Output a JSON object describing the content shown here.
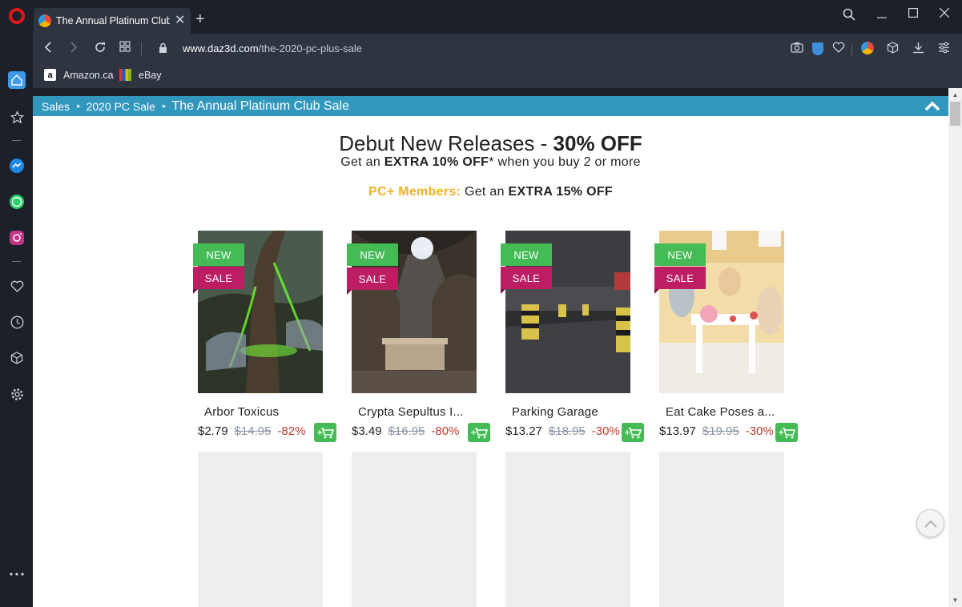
{
  "browser": {
    "tab_title": "The Annual Platinum Club Sale",
    "url_host": "www.daz3d.com",
    "url_path": "/the-2020-pc-plus-sale",
    "bookmarks": [
      {
        "label": "Amazon.ca",
        "icon": "amazon-icon"
      },
      {
        "label": "eBay",
        "icon": "ebay-icon"
      }
    ]
  },
  "breadcrumb": {
    "items": [
      "Sales",
      "2020 PC Sale"
    ],
    "current": "The Annual Platinum Club Sale"
  },
  "hero": {
    "title_prefix": "Debut New Releases - ",
    "title_bold": "30% OFF",
    "sub_prefix": "Get an ",
    "sub_bold": "EXTRA 10% OFF",
    "sub_suffix": "* when you buy 2 or more",
    "members_label": "PC+ Members:",
    "members_prefix": " Get an ",
    "members_bold": "EXTRA 15% OFF"
  },
  "badges": {
    "new": "NEW",
    "sale": "SALE"
  },
  "products": [
    {
      "name": "Arbor Toxicus",
      "price": "$2.79",
      "old_price": "$14.95",
      "discount": "-82%"
    },
    {
      "name": "Crypta Sepultus I...",
      "price": "$3.49",
      "old_price": "$16.95",
      "discount": "-80%"
    },
    {
      "name": "Parking Garage",
      "price": "$13.27",
      "old_price": "$18.95",
      "discount": "-30%"
    },
    {
      "name": "Eat Cake Poses a...",
      "price": "$13.97",
      "old_price": "$19.95",
      "discount": "-30%"
    }
  ],
  "colors": {
    "breadcrumb_bar": "#3197bd",
    "badge_new": "#44bb55",
    "badge_sale": "#bd1d62",
    "members_gold": "#f0b323",
    "discount": "#c0392b",
    "cart": "#44bb55"
  }
}
